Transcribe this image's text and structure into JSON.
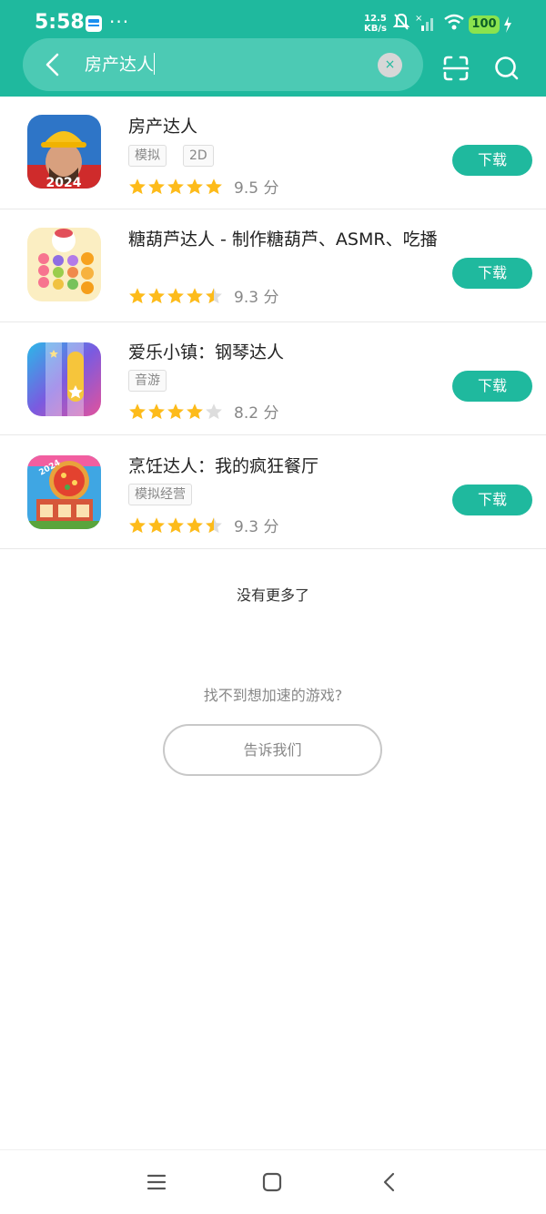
{
  "status_bar": {
    "time": "5:58",
    "dots": "···",
    "speed_value": "12.5",
    "speed_unit": "KB/s",
    "battery": "100"
  },
  "search": {
    "query": "房产达人",
    "clear_glyph": "×"
  },
  "icons": {
    "back": "chevron-left-icon",
    "clear": "close-icon",
    "scan": "scan-icon",
    "search": "search-icon"
  },
  "results": [
    {
      "title": "房产达人",
      "tags": [
        "模拟",
        "2D"
      ],
      "rating": 5,
      "score": "9.5 分",
      "button": "下载"
    },
    {
      "title": "糖葫芦达人 - 制作糖葫芦、ASMR、吃播",
      "tags": [],
      "rating": 4.5,
      "score": "9.3 分",
      "button": "下载"
    },
    {
      "title": "爱乐小镇：钢琴达人",
      "tags": [
        "音游"
      ],
      "rating": 4,
      "score": "8.2 分",
      "button": "下载"
    },
    {
      "title": "烹饪达人：我的疯狂餐厅",
      "tags": [
        "模拟经营"
      ],
      "rating": 4.5,
      "score": "9.3 分",
      "button": "下载"
    }
  ],
  "footer": {
    "no_more": "没有更多了",
    "cant_find": "找不到想加速的游戏?",
    "tell_us": "告诉我们"
  },
  "colors": {
    "brand": "#1fb99e",
    "star": "#fdbb1a",
    "star_empty": "#dddddd"
  }
}
